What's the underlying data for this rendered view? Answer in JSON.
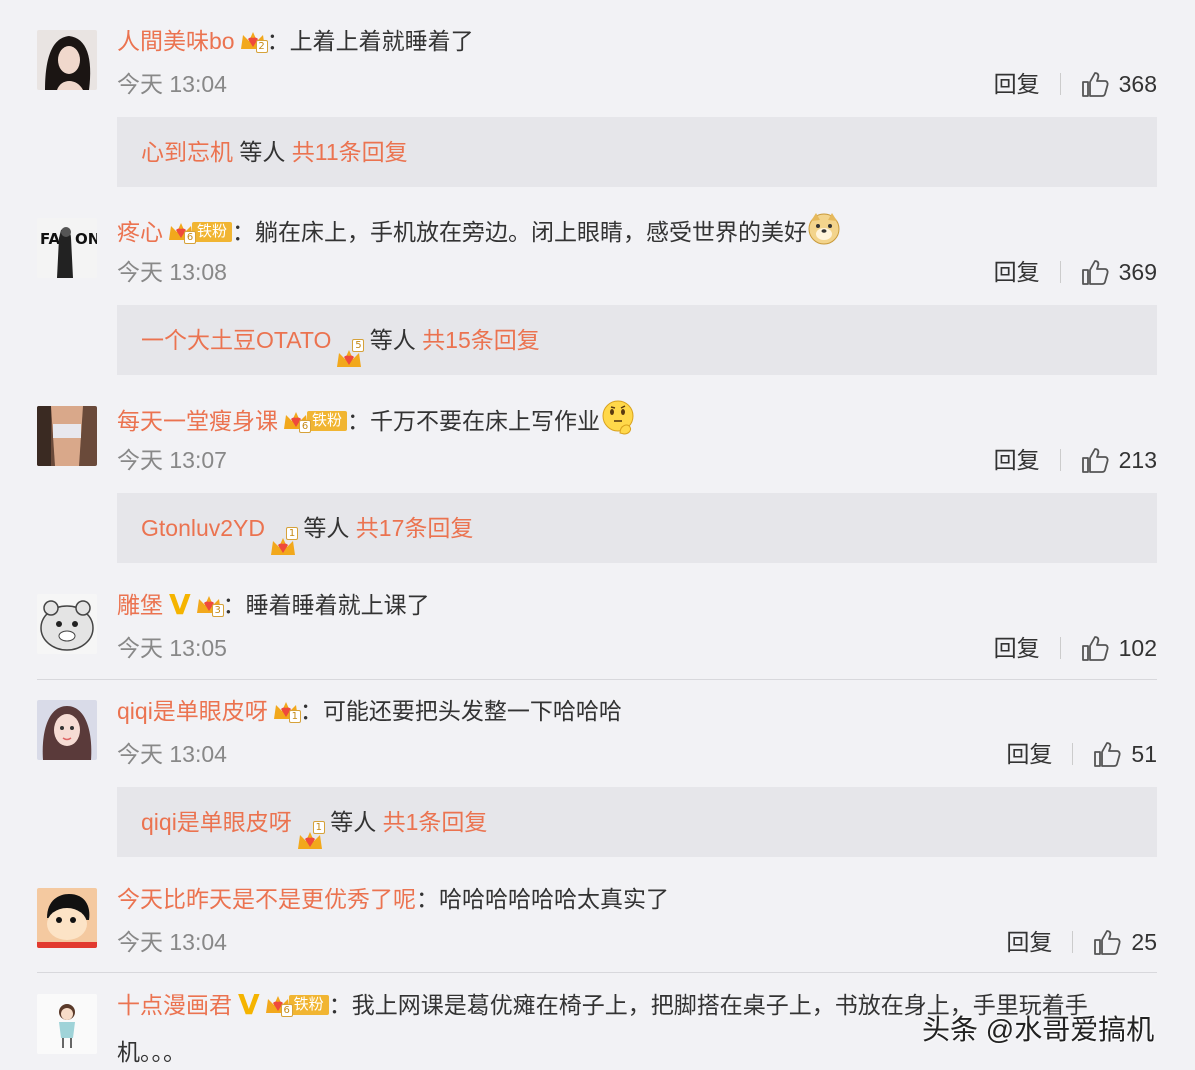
{
  "comments": [
    {
      "username": "人間美味bo",
      "level": "2",
      "fan": "",
      "verified": false,
      "text": "上着上着就睡着了",
      "emoji": "",
      "time": "今天 13:04",
      "reply_label": "回复",
      "likes": "368",
      "replies": {
        "name": "心到忘机",
        "level": "",
        "mid": "等人",
        "total": "共11条回复"
      }
    },
    {
      "username": "疼心",
      "level": "6",
      "fan": "铁粉",
      "verified": false,
      "text": "躺在床上，手机放在旁边。闭上眼睛，感受世界的美好",
      "emoji": "doge-emoji",
      "time": "今天 13:08",
      "reply_label": "回复",
      "likes": "369",
      "replies": {
        "name": "一个大土豆OTATO",
        "level": "5",
        "mid": "等人",
        "total": "共15条回复"
      }
    },
    {
      "username": "每天一堂瘦身课",
      "level": "6",
      "fan": "铁粉",
      "verified": false,
      "text": "千万不要在床上写作业",
      "emoji": "thinking-emoji",
      "time": "今天 13:07",
      "reply_label": "回复",
      "likes": "213",
      "replies": {
        "name": "Gtonluv2YD",
        "level": "1",
        "mid": "等人",
        "total": "共17条回复"
      }
    },
    {
      "username": "雕堡",
      "level": "3",
      "fan": "",
      "verified": true,
      "text": "睡着睡着就上课了",
      "emoji": "",
      "time": "今天 13:05",
      "reply_label": "回复",
      "likes": "102"
    },
    {
      "username": "qiqi是单眼皮呀",
      "level": "1",
      "fan": "",
      "verified": false,
      "text": "可能还要把头发整一下哈哈哈",
      "emoji": "",
      "time": "今天 13:04",
      "reply_label": "回复",
      "likes": "51",
      "replies": {
        "name": "qiqi是单眼皮呀",
        "level": "1",
        "mid": "等人",
        "total": "共1条回复"
      }
    },
    {
      "username": "今天比昨天是不是更优秀了呢",
      "level": "",
      "fan": "",
      "verified": false,
      "text": "哈哈哈哈哈哈太真实了",
      "emoji": "",
      "time": "今天 13:04",
      "reply_label": "回复",
      "likes": "25"
    },
    {
      "username": "十点漫画君",
      "level": "6",
      "fan": "铁粉",
      "verified": true,
      "text": "我上网课是葛优瘫在椅子上，把脚搭在桌子上，书放在身上，手里玩着手",
      "text_cont": "机。。。"
    }
  ],
  "colon": "：",
  "watermark": "头条 @水哥爱搞机",
  "colors": {
    "username": "#eb7350",
    "background": "#f2f2f5",
    "replybox": "#e6e6ea",
    "vip": "#f5b400"
  }
}
